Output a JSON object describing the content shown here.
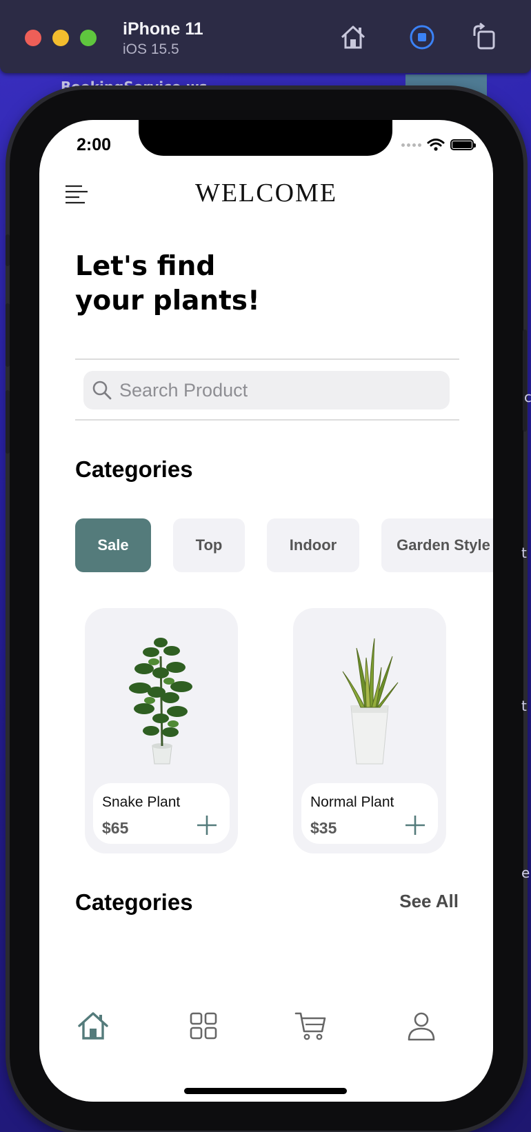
{
  "simulator": {
    "device_name": "iPhone 11",
    "os_version": "iOS 15.5",
    "background_window_title": "BookingService.ws"
  },
  "status_bar": {
    "time": "2:00"
  },
  "header": {
    "title": "WELCOME"
  },
  "hero": {
    "line1": "Let's find",
    "line2": "your plants!"
  },
  "search": {
    "placeholder": "Search Product"
  },
  "categories_section": {
    "title": "Categories",
    "chips": [
      {
        "label": "Sale",
        "active": true
      },
      {
        "label": "Top",
        "active": false
      },
      {
        "label": "Indoor",
        "active": false
      },
      {
        "label": "Garden Style",
        "active": false
      }
    ]
  },
  "products": [
    {
      "name": "Snake Plant",
      "price": "$65"
    },
    {
      "name": "Normal Plant",
      "price": "$35"
    }
  ],
  "second_section": {
    "title": "Categories",
    "see_all": "See All"
  },
  "tab_bar": {
    "items": [
      "home-icon",
      "grid-icon",
      "cart-icon",
      "profile-icon"
    ],
    "active": "home-icon"
  },
  "colors": {
    "accent": "#547b7b",
    "chip_bg": "#f2f2f6",
    "desktop_bg": "#2a22a8"
  }
}
